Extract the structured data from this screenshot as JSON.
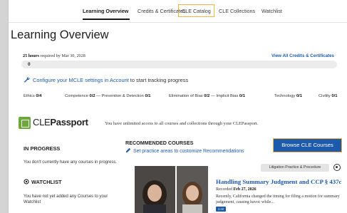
{
  "nav": {
    "tabs": [
      {
        "label": "Learning Overview",
        "active": true
      },
      {
        "label": "Credits & Certificates"
      },
      {
        "label": "CLE Catalog",
        "highlighted": true
      },
      {
        "label": "CLE Collections"
      },
      {
        "label": "Watchlist"
      }
    ]
  },
  "page_title": "Learning Overview",
  "requirement": {
    "hours_bold": "25 hours",
    "hours_rest": " required by Mar 30, 2028",
    "view_all": "View All Credits & Certificates",
    "progress_value": "0",
    "progress_fraction": 0
  },
  "config": {
    "link": "Configure your MCLE settings in Account",
    "rest": " to start tracking progress",
    "icon": "wrench-icon"
  },
  "categories": [
    {
      "name": "Ethics ",
      "value": "0/4"
    },
    {
      "name": "Competence ",
      "value": "0/2",
      "suffix": " — Prevention & Detection ",
      "value2": "0/1"
    },
    {
      "name": "Elimination of Bias ",
      "value": "0/2",
      "suffix": " — Implicit Bias ",
      "value2": "0/1"
    },
    {
      "name": "Technology ",
      "value": "0/1"
    },
    {
      "name": "Civility ",
      "value": "0/1"
    }
  ],
  "clep": {
    "logo_light": "CLE",
    "logo_bold": "Passport",
    "description": "You have unlimited access to all courses and collections through your CLEPassport."
  },
  "sidebar": {
    "in_progress_title": "IN PROGRESS",
    "in_progress_text": "You don't currently have any courses in progress.",
    "watchlist_title": "WATCHLIST",
    "watchlist_text": "You have not yet added any Courses to your Watchlist"
  },
  "recommended": {
    "title": "RECOMMENDED COURSES",
    "set_link": "Set practice areas to customize Recommendations",
    "browse_button": "Browse CLE Courses"
  },
  "course_card": {
    "tag": "Litigation Practice & Procedure",
    "title": "Handling Summary Judgment and CCP § 437c",
    "recorded_label": "Recorded ",
    "recorded_date": "Feb 27, 2026",
    "description": "Recently, California changed the timing for filing a motion for summary judgement, causing havoc while...",
    "chip": "1 Hr"
  },
  "colors": {
    "link_blue": "#1f5aa8",
    "button_blue": "#1d5aab",
    "highlight_orange": "#f2b340",
    "logo_green": "#6ca83a"
  }
}
